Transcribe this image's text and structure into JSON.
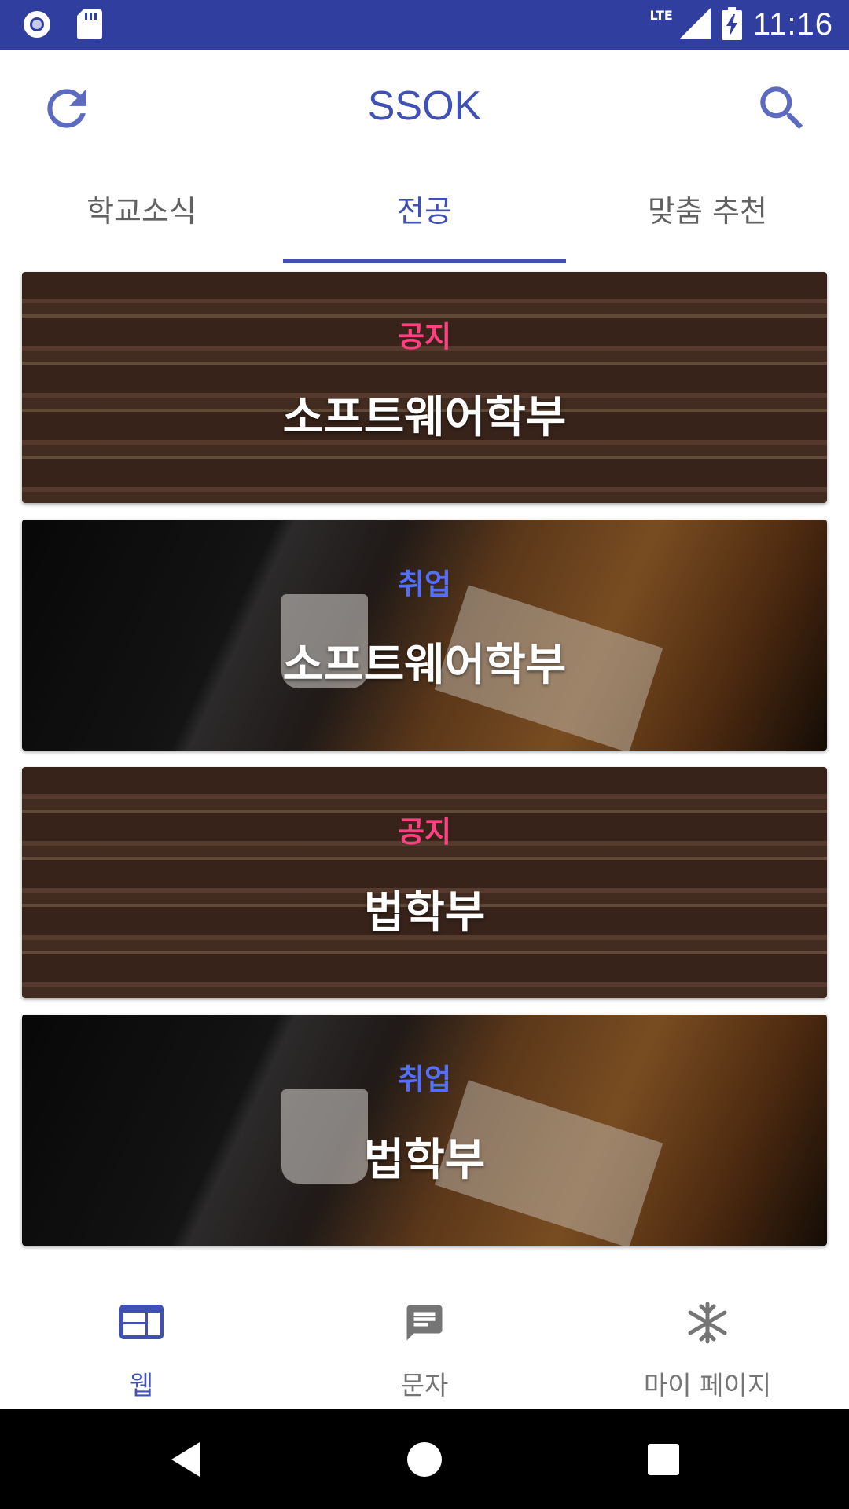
{
  "status_bar": {
    "network": "LTE",
    "time": "11:16",
    "colors": {
      "background": "#303f9f"
    }
  },
  "app_bar": {
    "title": "SSOK",
    "icons": {
      "left": "refresh-icon",
      "right": "search-icon"
    }
  },
  "tabs": [
    {
      "label": "학교소식",
      "active": false
    },
    {
      "label": "전공",
      "active": true
    },
    {
      "label": "맞춤 추천",
      "active": false
    }
  ],
  "cards": [
    {
      "category": "공지",
      "title": "소프트웨어학부",
      "image": "books"
    },
    {
      "category": "취업",
      "title": "소프트웨어학부",
      "image": "desk"
    },
    {
      "category": "공지",
      "title": "법학부",
      "image": "books"
    },
    {
      "category": "취업",
      "title": "법학부",
      "image": "desk"
    }
  ],
  "bottom_nav": [
    {
      "label": "웹",
      "icon": "web-icon",
      "active": true
    },
    {
      "label": "문자",
      "icon": "message-icon",
      "active": false
    },
    {
      "label": "마이 페이지",
      "icon": "asterisk-icon",
      "active": false
    }
  ],
  "system_nav": {
    "icons": [
      "back-icon",
      "home-icon",
      "recents-icon"
    ]
  },
  "colors": {
    "primary": "#3f51b5",
    "status_bar": "#303f9f",
    "notice_accent": "#ff4081",
    "job_accent": "#536dfe"
  }
}
